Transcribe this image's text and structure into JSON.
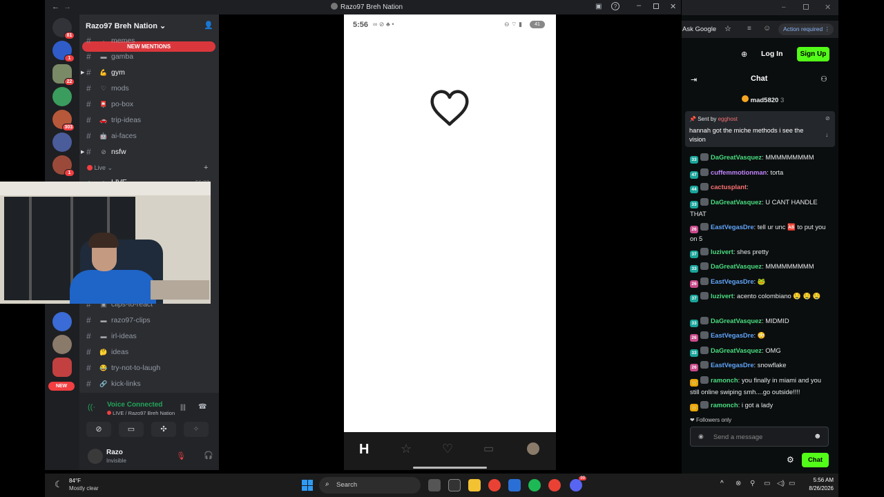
{
  "discord": {
    "title": "Razo97 Breh Nation",
    "server_name": "Razo97 Breh Nation",
    "new_mentions": "NEW MENTIONS",
    "channels_top": [
      {
        "name": "memes",
        "emoji": "·",
        "unread": false
      },
      {
        "name": "gamba",
        "emoji": "▬",
        "unread": false
      },
      {
        "name": "gym",
        "emoji": "💪",
        "unread": true
      },
      {
        "name": "mods",
        "emoji": "♡",
        "unread": false
      },
      {
        "name": "po-box",
        "emoji": "📮",
        "unread": false
      },
      {
        "name": "trip-ideas",
        "emoji": "🚗",
        "unread": false
      },
      {
        "name": "ai-faces",
        "emoji": "🤖",
        "unread": false
      },
      {
        "name": "nsfw",
        "emoji": "⊘",
        "unread": true
      }
    ],
    "live_category": "Live",
    "live_channel": "LIVE",
    "live_time": "56:37",
    "channels_bottom": [
      {
        "name": "clips-to-react",
        "emoji": "▣"
      },
      {
        "name": "razo97-clips",
        "emoji": "▬"
      },
      {
        "name": "irl-ideas",
        "emoji": "▬"
      },
      {
        "name": "ideas",
        "emoji": "🤔"
      },
      {
        "name": "try-not-to-laugh",
        "emoji": "😂"
      },
      {
        "name": "kick-links",
        "emoji": "🔗"
      }
    ],
    "server_badges": [
      "81",
      "1",
      "22",
      "",
      "303",
      "",
      "",
      "1"
    ],
    "new_label": "NEW",
    "voice_status": "Voice Connected",
    "voice_channel": "LIVE / Razo97 Breh Nation",
    "user_name": "Razo",
    "user_status": "Invisible"
  },
  "phone": {
    "time": "5:56",
    "battery": "41"
  },
  "kick": {
    "ask_google": "Ask Google",
    "action_required": "Action required",
    "login": "Log In",
    "signup": "Sign Up",
    "chat_title": "Chat",
    "pinned_user": "mad5820",
    "pinned_count": "3",
    "sent_by": "Sent by",
    "sent_by_user": "egghost",
    "pinned_text": "hannah got the miche methods i see the vision",
    "messages": [
      {
        "badge": "33",
        "user": "DaGreatVasquez",
        "color": "#4ade80",
        "text": "MMMMMMMMM"
      },
      {
        "badge": "47",
        "user": "cuffemmotionman",
        "color": "#c084fc",
        "text": "torta"
      },
      {
        "badge": "44",
        "user": "cactusplant",
        "color": "#f87171",
        "text": ""
      },
      {
        "badge": "33",
        "user": "DaGreatVasquez",
        "color": "#4ade80",
        "text": "U CANT HANDLE THAT"
      },
      {
        "badge": "26",
        "user": "EastVegasDre",
        "color": "#60a5fa",
        "text": "tell ur unc 🆎 to put you on 5"
      },
      {
        "badge": "37",
        "user": "luzivert",
        "color": "#4ade80",
        "text": "shes pretty"
      },
      {
        "badge": "33",
        "user": "DaGreatVasquez",
        "color": "#4ade80",
        "text": "MMMMMMMMM"
      },
      {
        "badge": "26",
        "user": "EastVegasDre",
        "color": "#60a5fa",
        "text": "🐸"
      },
      {
        "badge": "37",
        "user": "luzivert",
        "color": "#4ade80",
        "text": "acento colombiano 🤤 🤤 🤤"
      },
      {
        "badge": "33",
        "user": "DaGreatVasquez",
        "color": "#4ade80",
        "text": "MIDMID"
      },
      {
        "badge": "26",
        "user": "EastVegasDre",
        "color": "#60a5fa",
        "text": "😳"
      },
      {
        "badge": "33",
        "user": "DaGreatVasquez",
        "color": "#4ade80",
        "text": "OMG"
      },
      {
        "badge": "26",
        "user": "EastVegasDre",
        "color": "#60a5fa",
        "text": "snowflake"
      },
      {
        "badge": "👑",
        "user": "ramonch",
        "color": "#4ade80",
        "text": "you finally in miami and you still online swiping smh....go outside!!!!"
      },
      {
        "badge": "👑",
        "user": "ramonch",
        "color": "#4ade80",
        "text": "i got a lady"
      }
    ],
    "followers_only": "Followers only",
    "send_placeholder": "Send a message",
    "chat_button": "Chat"
  },
  "taskbar": {
    "weather_temp": "84°F",
    "weather_desc": "Mostly clear",
    "search": "Search",
    "time": "5:56 AM",
    "date": "8/26/2026",
    "discord_badge": "99"
  }
}
